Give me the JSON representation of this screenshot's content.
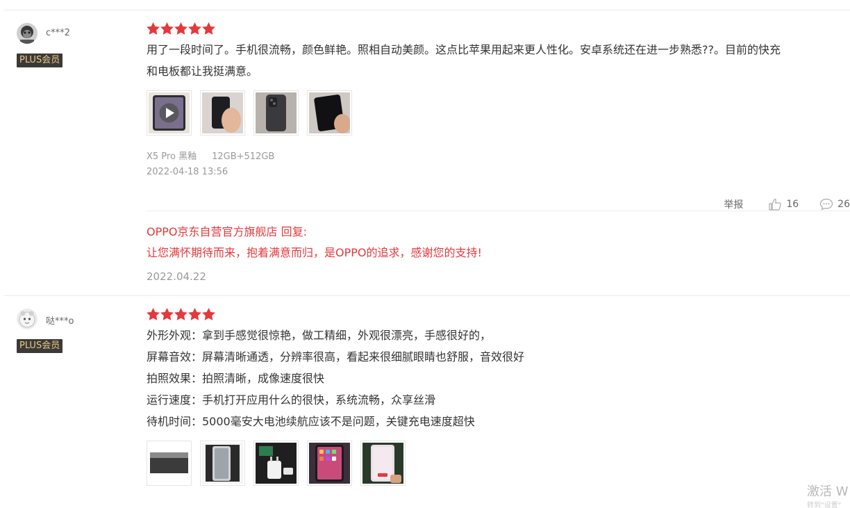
{
  "reviews": [
    {
      "username": "c***2",
      "badge": "PLUS会员",
      "rating": 5,
      "text_lines": [
        "用了一段时间了。手机很流畅，颜色鲜艳。照相自动美颜。这点比苹果用起来更人性化。安卓系统还在进一步熟悉??。目前的快充",
        "和电板都让我挺满意。"
      ],
      "images": [
        "video-thumbnail",
        "phone-in-hand",
        "phone-back",
        "phone-dark"
      ],
      "spec_color": "X5 Pro 黑釉",
      "spec_storage": "12GB+512GB",
      "date": "2022-04-18 13:56",
      "report_label": "举报",
      "likes": "16",
      "comments": "26",
      "reply": {
        "title": "OPPO京东自营官方旗舰店 回复:",
        "text": "让您满怀期待而来，抱着满意而归，是OPPO的追求，感谢您的支持!",
        "date": "2022.04.22"
      }
    },
    {
      "username": "哒***o",
      "badge": "PLUS会员",
      "rating": 5,
      "text_lines": [
        "外形外观：拿到手感觉很惊艳，做工精细，外观很漂亮，手感很好的，",
        "屏幕音效：屏幕清晰通透，分辨率很高，看起来很细腻眼睛也舒服，音效很好",
        "拍照效果：拍照清晰，成像速度很快",
        "运行速度：手机打开应用什么的很快，系统流畅，众享丝滑",
        "待机时间：5000毫安大电池续航应该不是问题，关键充电速度超快"
      ],
      "images": [
        "phone-box",
        "phone-front",
        "accessories",
        "phone-screen",
        "phone-boot"
      ]
    }
  ],
  "watermark": {
    "main": "激活 W",
    "sub": "转到\"设置\""
  },
  "colors": {
    "star": "#e4393c",
    "reply": "#e4393c",
    "badge_bg": "#3c3a36",
    "badge_text": "#e7c98c",
    "muted": "#999999"
  }
}
